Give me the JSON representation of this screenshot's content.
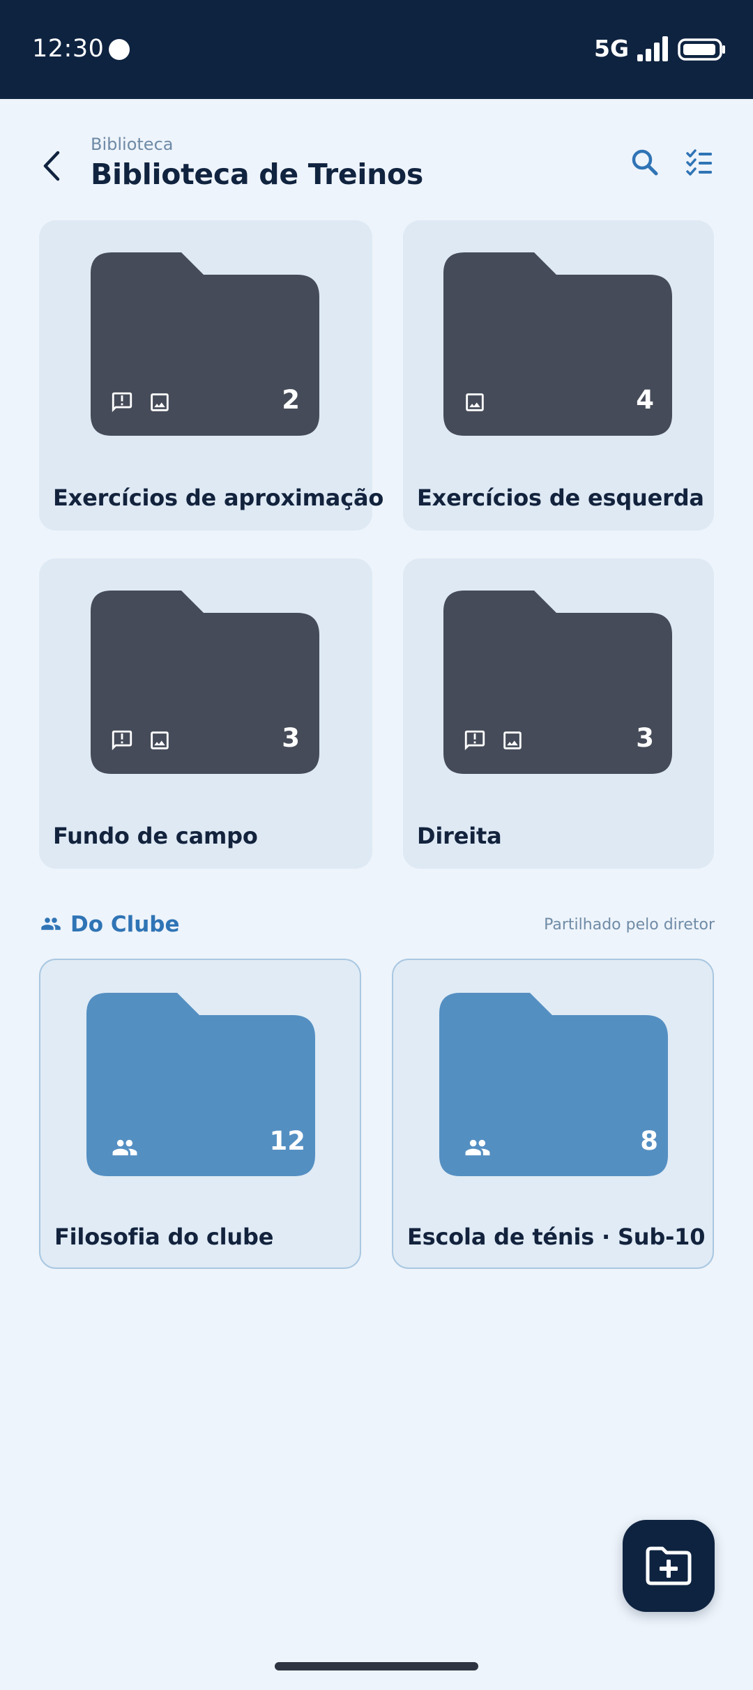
{
  "status_bar": {
    "time": "12:30",
    "network": "5G"
  },
  "header": {
    "breadcrumb": "Biblioteca",
    "title": "Biblioteca de Treinos"
  },
  "folders": [
    {
      "title": "Exercícios de aproximação",
      "count": "2",
      "badges": [
        "feedback-icon",
        "image-icon"
      ]
    },
    {
      "title": "Exercícios de esquerda",
      "count": "4",
      "badges": [
        "image-icon"
      ]
    },
    {
      "title": "Fundo de campo",
      "count": "3",
      "badges": [
        "feedback-icon",
        "image-icon"
      ]
    },
    {
      "title": "Direita",
      "count": "3",
      "badges": [
        "feedback-icon",
        "image-icon"
      ]
    }
  ],
  "club_section": {
    "title": "Do Clube",
    "note": "Partilhado pelo diretor",
    "folders": [
      {
        "title": "Filosofia do clube",
        "count": "12",
        "badges": [
          "group-icon"
        ]
      },
      {
        "title": "Escola de ténis · Sub-10",
        "count": "8",
        "badges": [
          "group-icon"
        ]
      }
    ]
  },
  "colors": {
    "status_bar": "#0E2340",
    "background": "#EEF4FB",
    "card": "#DEE9F4",
    "folder_dark": "#454B58",
    "folder_shared": "#548FC2",
    "accent": "#2F74B5",
    "fab": "#0E2340"
  },
  "icons": {
    "back": "chevron-left-icon",
    "search": "search-icon",
    "checklist": "checklist-icon",
    "section": "group-icon",
    "fab": "create-folder-icon"
  }
}
